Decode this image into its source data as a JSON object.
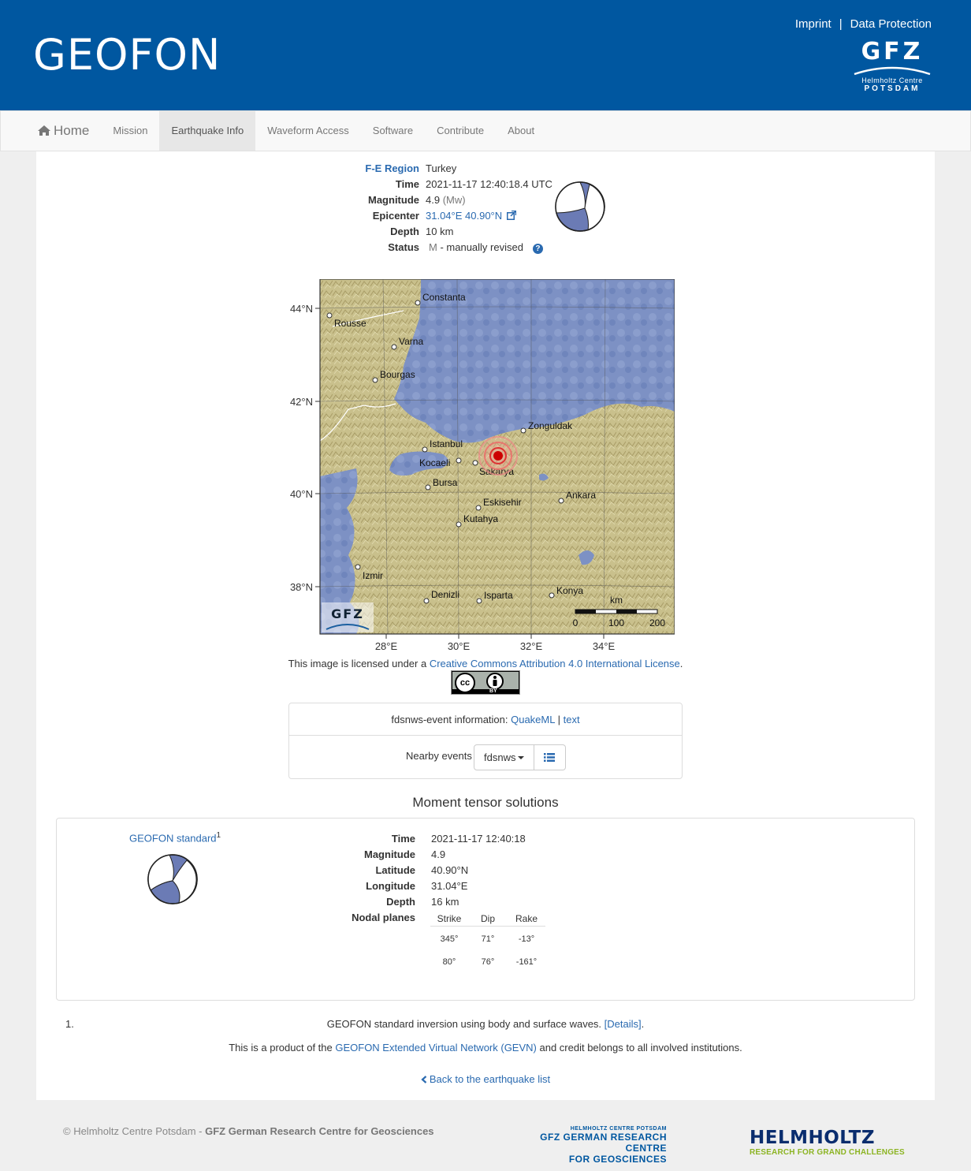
{
  "header": {
    "brand": "GEOFON",
    "imprint": "Imprint",
    "separator": "|",
    "data_protection": "Data Protection",
    "logo": {
      "gfz": "GFZ",
      "line1": "Helmholtz Centre",
      "line2": "POTSDAM"
    },
    "bg_color": "#0057a0"
  },
  "nav": {
    "home": "Home",
    "items": [
      "Mission",
      "Earthquake Info",
      "Waveform Access",
      "Software",
      "Contribute",
      "About"
    ],
    "active": "Earthquake Info"
  },
  "event": {
    "region_label": "F-E Region",
    "region": "Turkey",
    "time_label": "Time",
    "time": "2021-11-17 12:40:18.4 UTC",
    "magnitude_label": "Magnitude",
    "magnitude": "4.9",
    "magnitude_type": "(Mw)",
    "epicenter_label": "Epicenter",
    "epicenter": "31.04°E 40.90°N",
    "depth_label": "Depth",
    "depth": "10 km",
    "status_label": "Status",
    "status_code": "M",
    "status_text": "- manually revised",
    "help_icon": "question-circle-icon"
  },
  "map": {
    "lat_labels": [
      "44°N",
      "42°N",
      "40°N",
      "38°N"
    ],
    "lon_labels": [
      "28°E",
      "30°E",
      "32°E",
      "34°E"
    ],
    "cities": [
      "Constanta",
      "Rousse",
      "Varna",
      "Bourgas",
      "Zonguldak",
      "Istanbul",
      "Kocaeli",
      "Sakarya",
      "Bursa",
      "Eskisehir",
      "Ankara",
      "Kutahya",
      "Izmir",
      "Denizli",
      "Isparta",
      "Konya"
    ],
    "scale": {
      "unit": "km",
      "ticks": [
        "0",
        "100",
        "200"
      ]
    },
    "watermark": "GFZ"
  },
  "license": {
    "prefix": "This image is licensed under a ",
    "link": "Creative Commons Attribution 4.0 International License",
    "suffix": ".",
    "badge_cc": "cc",
    "badge_by": "BY"
  },
  "fdsn": {
    "label": "fdsnws-event information: ",
    "quakeml": "QuakeML",
    "sep": "|",
    "text": "text",
    "nearby_label": "Nearby events",
    "dropdown": "fdsnws"
  },
  "moment_tensor": {
    "title": "Moment tensor solutions",
    "name": "GEOFON standard",
    "footnote_ref": "1",
    "time_label": "Time",
    "time": "2021-11-17 12:40:18",
    "magnitude_label": "Magnitude",
    "magnitude": "4.9",
    "latitude_label": "Latitude",
    "latitude": "40.90°N",
    "longitude_label": "Longitude",
    "longitude": "31.04°E",
    "depth_label": "Depth",
    "depth": "16 km",
    "nodal_label": "Nodal planes",
    "headers": [
      "Strike",
      "Dip",
      "Rake"
    ],
    "planes": [
      [
        "345°",
        "71°",
        "-13°"
      ],
      [
        "80°",
        "76°",
        "-161°"
      ]
    ]
  },
  "notes": {
    "num": "1.",
    "text": "GEOFON standard inversion using body and surface waves. ",
    "details": "[Details]",
    "details_suffix": ".",
    "credit_prefix": "This is a product of the ",
    "credit_link": "GEOFON Extended Virtual Network (GEVN)",
    "credit_suffix": " and credit belongs to all involved institutions.",
    "back": "Back to the earthquake list"
  },
  "footer": {
    "copy": "© Helmholtz Centre Potsdam - ",
    "copy_bold": "GFZ German Research Centre for Geosciences",
    "gfz_l1": "HELMHOLTZ CENTRE POTSDAM",
    "gfz_l2": "GFZ GERMAN RESEARCH CENTRE",
    "gfz_l3": "FOR GEOSCIENCES",
    "helm_1": "HELMHOLTZ",
    "helm_2": "RESEARCH FOR GRAND CHALLENGES"
  }
}
